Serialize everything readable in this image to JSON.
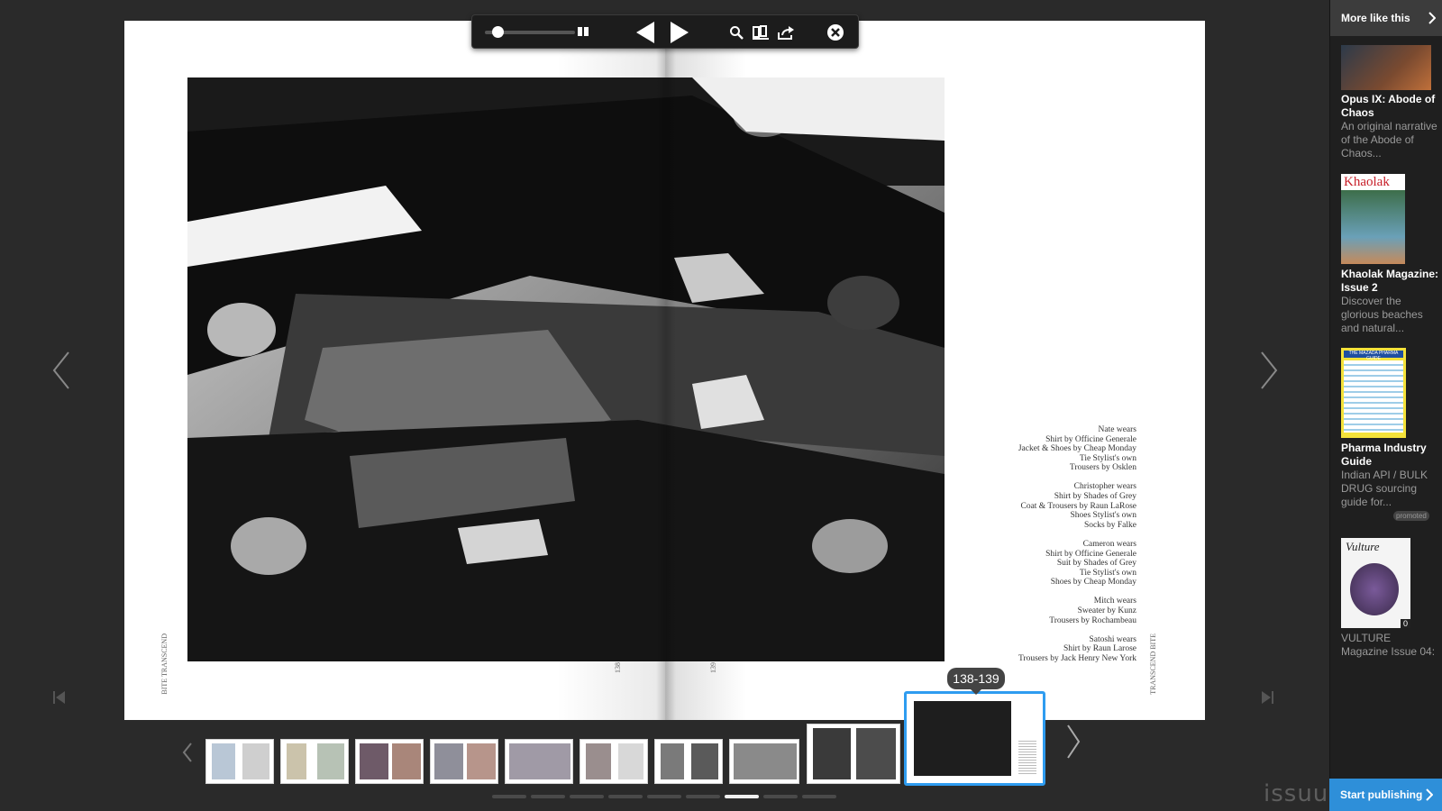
{
  "toolbar": {
    "zoom_slider": "zoom-slider",
    "icons": [
      "grid-view-icon",
      "previous-icon",
      "play-next-icon",
      "search-icon",
      "library-icon",
      "share-icon",
      "close-icon"
    ]
  },
  "page_numbers": {
    "left": "138",
    "right": "139"
  },
  "folio": {
    "left": "BITE TRANSCEND",
    "right": "TRANSCEND BITE"
  },
  "credits": [
    [
      "Nate wears",
      "Shirt by Officine Generale",
      "Jacket & Shoes by Cheap Monday",
      "Tie Stylist's own",
      "Trousers by Osklen"
    ],
    [
      "Christopher wears",
      "Shirt by Shades of Grey",
      "Coat & Trousers by Raun LaRose",
      "Shoes Stylist's own",
      "Socks by Falke"
    ],
    [
      "Cameron wears",
      "Shirt by Officine Generale",
      "Suit by Shades of Grey",
      "Tie Stylist's own",
      "Shoes by Cheap Monday"
    ],
    [
      "Mitch wears",
      "Sweater by Kunz",
      "Trousers by Rochambeau"
    ],
    [
      "Satoshi wears",
      "Shirt by Raun Larose",
      "Trousers by Jack Henry New York"
    ]
  ],
  "thumb_tooltip": "138-139",
  "thumbnails_count": 11,
  "active_thumbnail": 10,
  "page_dots": {
    "count": 9,
    "active": 7
  },
  "sidebar": {
    "header": "More like this",
    "items": [
      {
        "title": "Opus IX: Abode of Chaos",
        "desc": "An original narrative of the Abode of Chaos..."
      },
      {
        "title": "Khaolak Magazine: Issue 2",
        "desc": "Discover the glorious beaches and natural...",
        "cover_text": "Khaolak"
      },
      {
        "title": "Pharma Industry Guide",
        "desc": "Indian API / BULK DRUG sourcing guide for...",
        "badge": "promoted",
        "cover_text": "THE MAZADA PHARMA GUIDE"
      },
      {
        "title": "",
        "desc": "VULTURE Magazine Issue 04:",
        "cover_text": "Vulture",
        "count": "0"
      }
    ],
    "start_publishing": "Start publishing"
  },
  "brand": "issuu",
  "colors": {
    "accent": "#2e9cf0",
    "publish": "#2e8fd9",
    "background": "#2a2a2a"
  }
}
